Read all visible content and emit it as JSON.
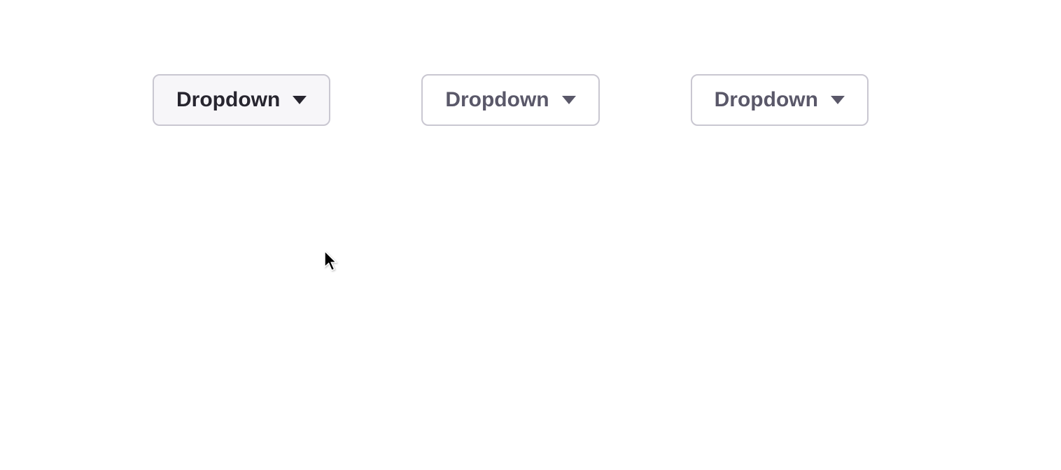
{
  "dropdowns": [
    {
      "label": "Dropdown",
      "hovered": true
    },
    {
      "label": "Dropdown",
      "hovered": false
    },
    {
      "label": "Dropdown",
      "hovered": false
    }
  ]
}
